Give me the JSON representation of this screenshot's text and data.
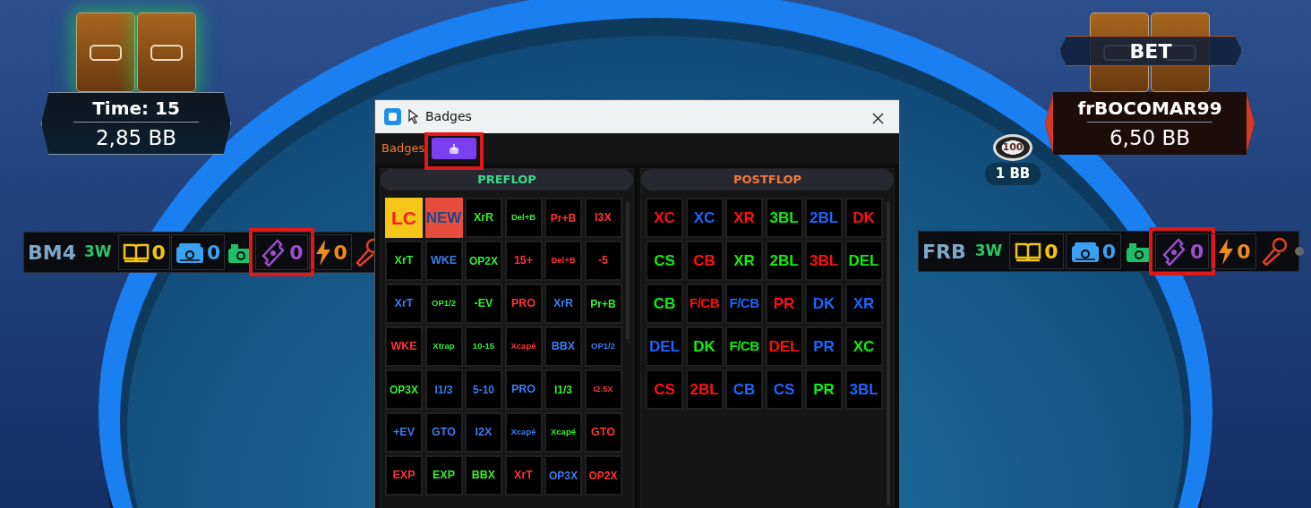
{
  "seats": [
    {
      "kind": "timer",
      "title": "Time: 15",
      "stack": "2,85 BB",
      "active": true
    },
    {
      "kind": "player",
      "title": "frBOCOMAR99",
      "stack": "6,50 BB",
      "active": false,
      "action": "BET"
    }
  ],
  "bet_chip": {
    "chip": "100",
    "amount": "1 BB"
  },
  "huds": [
    {
      "tag": "BM4",
      "label": "3W",
      "stats": [
        {
          "kind": "book",
          "value": "0",
          "highlighted": false
        },
        {
          "kind": "wallet",
          "value": "0",
          "highlighted": false
        },
        {
          "kind": "camera",
          "highlighted": false
        },
        {
          "kind": "ticket",
          "value": "0",
          "highlighted": true
        },
        {
          "kind": "bolt",
          "value": "0",
          "highlighted": false
        },
        {
          "kind": "mic",
          "highlighted": false
        }
      ]
    },
    {
      "tag": "FRB",
      "label": "3W",
      "stats": [
        {
          "kind": "book",
          "value": "0",
          "highlighted": false
        },
        {
          "kind": "wallet",
          "value": "0",
          "highlighted": false
        },
        {
          "kind": "camera",
          "highlighted": false
        },
        {
          "kind": "ticket",
          "value": "0",
          "highlighted": true
        },
        {
          "kind": "bolt",
          "value": "0",
          "highlighted": false
        },
        {
          "kind": "mic",
          "highlighted": false
        },
        {
          "kind": "dot",
          "highlighted": false
        }
      ]
    }
  ],
  "dialog": {
    "title": "Badges",
    "toolbar_label": "Badges",
    "export_button_highlighted": true,
    "panels": [
      {
        "title": "PREFLOP",
        "color": "#3ad98a",
        "badges": [
          {
            "kind": "filled",
            "color": "#f5c518",
            "label": {
              "text": "LC",
              "color": "#ff1a1a"
            }
          },
          {
            "kind": "filled",
            "color": "#e84c3d",
            "label": {
              "text": "NEW",
              "color": "#164a8c"
            }
          },
          {
            "text": "XrR",
            "color": "#33ee33"
          },
          {
            "text": "Del+B",
            "color": "#33ee33"
          },
          {
            "text": "Pr+B",
            "color": "#ff3333"
          },
          {
            "text": "I3X",
            "color": "#ff3333"
          },
          {
            "text": "XrT",
            "color": "#33ee33"
          },
          {
            "text": "WKE",
            "color": "#3a7df0"
          },
          {
            "text": "OP2X",
            "color": "#33ee33"
          },
          {
            "text": "15+",
            "color": "#ff3333"
          },
          {
            "text": "Del+B",
            "color": "#ff3333"
          },
          {
            "text": "-5",
            "color": "#ff3333"
          },
          {
            "text": "XrT",
            "color": "#3a7df0"
          },
          {
            "text": "OP1/2",
            "color": "#33ee33"
          },
          {
            "text": "-EV",
            "color": "#33ee33"
          },
          {
            "text": "PRO",
            "color": "#ff3333"
          },
          {
            "text": "XrR",
            "color": "#3a7df0"
          },
          {
            "text": "Pr+B",
            "color": "#33ee33"
          },
          {
            "text": "WKE",
            "color": "#ff3333"
          },
          {
            "text": "Xtrap",
            "color": "#33ee33"
          },
          {
            "text": "10-15",
            "color": "#33ee33"
          },
          {
            "text": "Xcapé",
            "color": "#ff3333"
          },
          {
            "text": "BBX",
            "color": "#3a7df0"
          },
          {
            "text": "OP1/2",
            "color": "#3a7df0"
          },
          {
            "text": "OP3X",
            "color": "#33ee33"
          },
          {
            "text": "I1/3",
            "color": "#3a7df0"
          },
          {
            "text": "5-10",
            "color": "#3a7df0"
          },
          {
            "text": "PRO",
            "color": "#3a7df0"
          },
          {
            "text": "I1/3",
            "color": "#33ee33"
          },
          {
            "text": "I2.5X",
            "color": "#ff3333"
          },
          {
            "text": "+EV",
            "color": "#3a7df0"
          },
          {
            "text": "GTO",
            "color": "#3a7df0"
          },
          {
            "text": "I2X",
            "color": "#3a7df0"
          },
          {
            "text": "Xcapé",
            "color": "#3a7df0"
          },
          {
            "text": "Xcapé",
            "color": "#33ee33"
          },
          {
            "text": "GTO",
            "color": "#ff3333"
          },
          {
            "text": "EXP",
            "color": "#ff3333"
          },
          {
            "text": "EXP",
            "color": "#33ee33"
          },
          {
            "text": "BBX",
            "color": "#33ee33"
          },
          {
            "text": "XrT",
            "color": "#ff3333"
          },
          {
            "text": "OP3X",
            "color": "#3a7df0"
          },
          {
            "text": "OP2X",
            "color": "#ff3333"
          }
        ]
      },
      {
        "title": "POSTFLOP",
        "color": "#f07a3a",
        "badges": [
          {
            "text": "XC",
            "color": "#ff1010"
          },
          {
            "text": "XC",
            "color": "#1a66ff"
          },
          {
            "text": "XR",
            "color": "#ff1010"
          },
          {
            "text": "3BL",
            "color": "#10ee10"
          },
          {
            "text": "2BL",
            "color": "#1a66ff"
          },
          {
            "text": "DK",
            "color": "#ff1010"
          },
          {
            "text": "CS",
            "color": "#10ee10"
          },
          {
            "text": "CB",
            "color": "#ff1010"
          },
          {
            "text": "XR",
            "color": "#10ee10"
          },
          {
            "text": "2BL",
            "color": "#10ee10"
          },
          {
            "text": "3BL",
            "color": "#ff1010"
          },
          {
            "text": "DEL",
            "color": "#10ee10"
          },
          {
            "text": "CB",
            "color": "#10ee10"
          },
          {
            "text": "F/CB",
            "color": "#ff1010"
          },
          {
            "text": "F/CB",
            "color": "#1a66ff"
          },
          {
            "text": "PR",
            "color": "#ff1010"
          },
          {
            "text": "DK",
            "color": "#1a66ff"
          },
          {
            "text": "XR",
            "color": "#1a66ff"
          },
          {
            "text": "DEL",
            "color": "#1a66ff"
          },
          {
            "text": "DK",
            "color": "#10ee10"
          },
          {
            "text": "F/CB",
            "color": "#10ee10"
          },
          {
            "text": "DEL",
            "color": "#ff1010"
          },
          {
            "text": "PR",
            "color": "#1a66ff"
          },
          {
            "text": "XC",
            "color": "#10ee10"
          },
          {
            "text": "CS",
            "color": "#ff1010"
          },
          {
            "text": "2BL",
            "color": "#ff1010"
          },
          {
            "text": "CB",
            "color": "#1a66ff"
          },
          {
            "text": "CS",
            "color": "#1a66ff"
          },
          {
            "text": "PR",
            "color": "#10ee10"
          },
          {
            "text": "3BL",
            "color": "#1a66ff"
          }
        ]
      }
    ]
  }
}
